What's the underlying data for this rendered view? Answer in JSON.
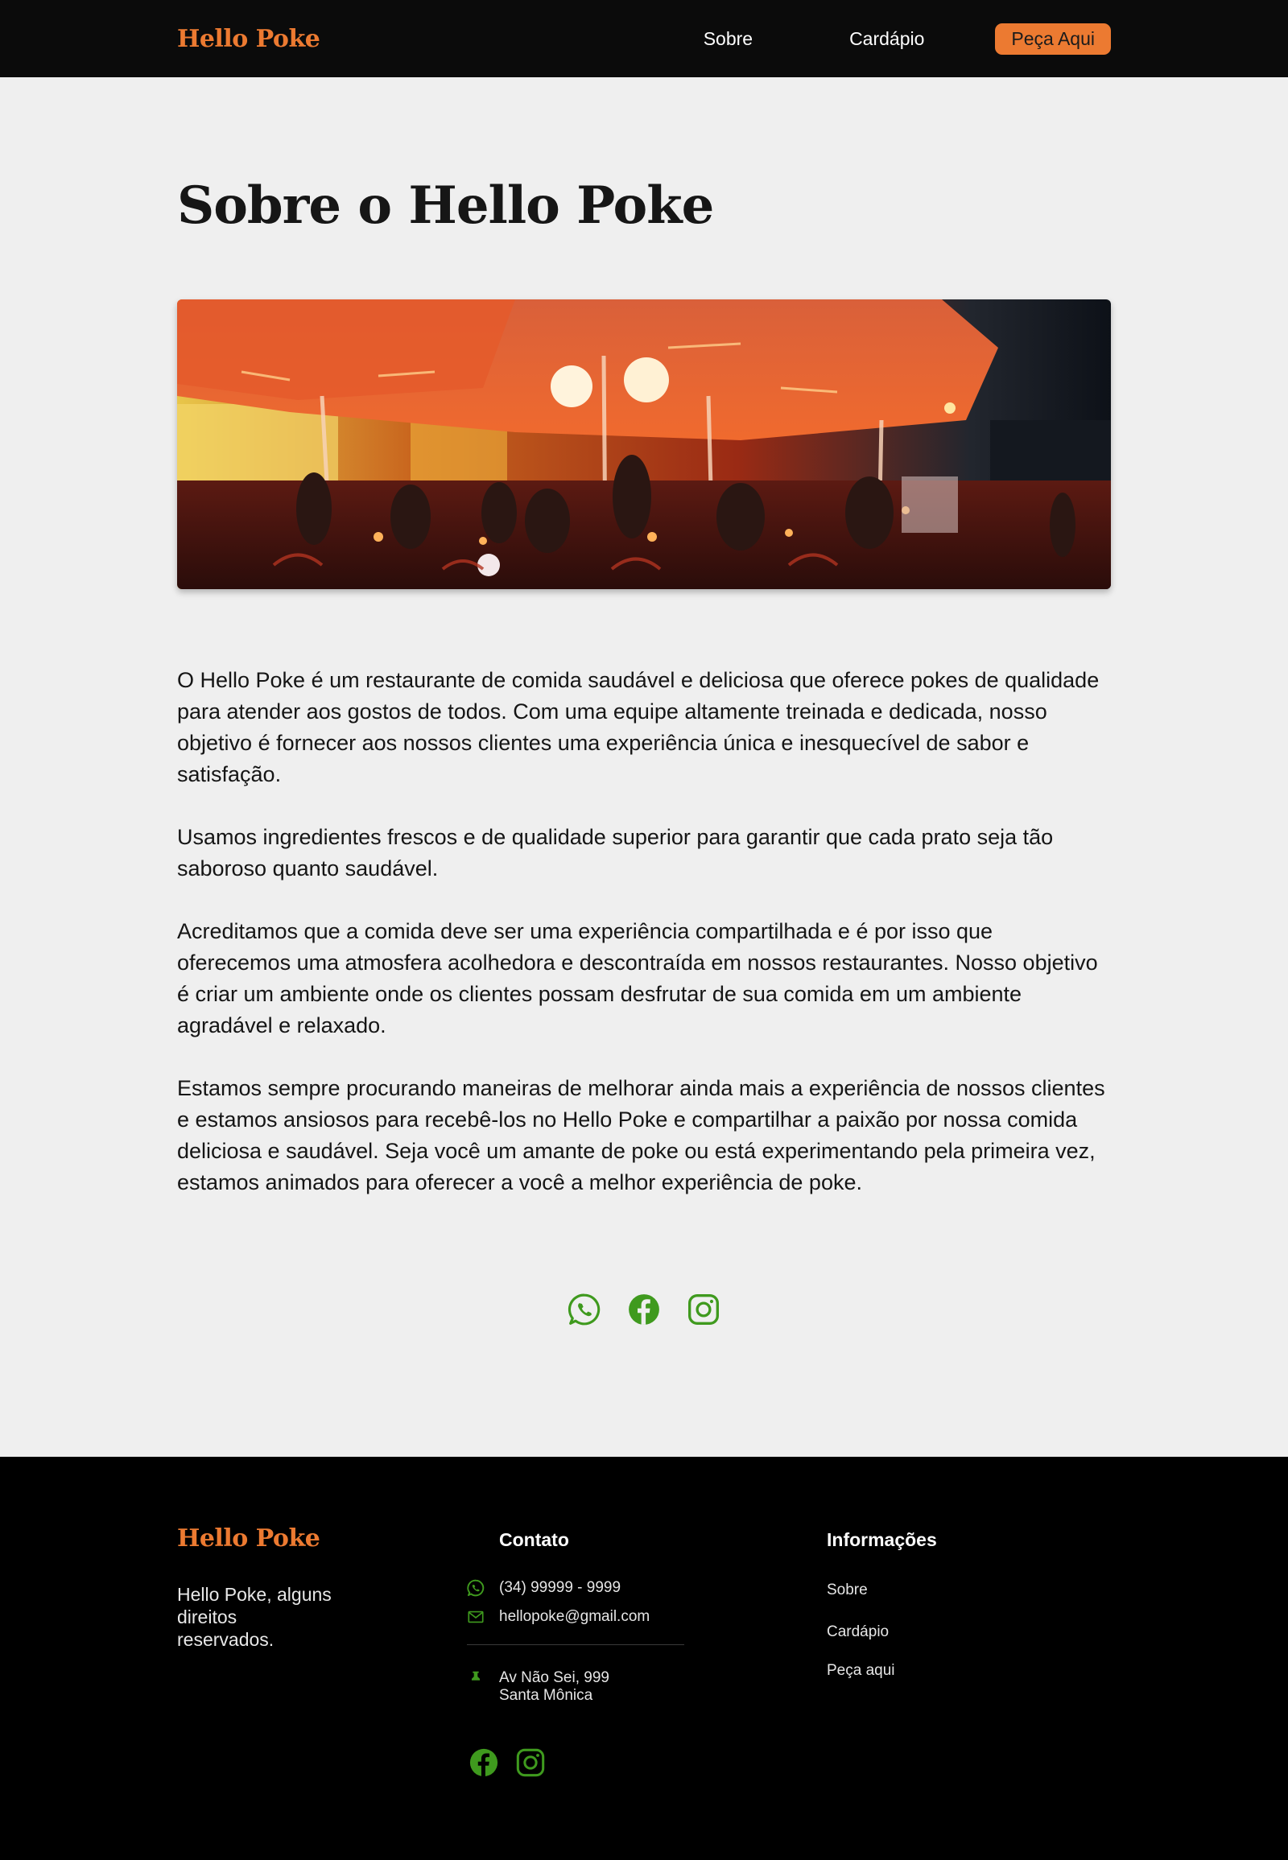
{
  "header": {
    "brand": "Hello Poke",
    "nav": {
      "sobre": "Sobre",
      "cardapio": "Cardápio",
      "cta": "Peça Aqui"
    }
  },
  "main": {
    "title": "Sobre o Hello Poke",
    "paragraphs": [
      "O Hello Poke é um restaurante de comida saudável e deliciosa que oferece pokes de qualidade para atender aos gostos de todos. Com uma equipe altamente treinada e dedicada, nosso objetivo é fornecer aos nossos clientes uma experiência única e inesquecível de sabor e satisfação.",
      "Usamos ingredientes frescos e de qualidade superior para garantir que cada prato seja tão saboroso quanto saudável.",
      "Acreditamos que a comida deve ser uma experiência compartilhada e é por isso que oferecemos uma atmosfera acolhedora e descontraída em nossos restaurantes. Nosso objetivo é criar um ambiente onde os clientes possam desfrutar de sua comida em um ambiente agradável e relaxado.",
      "Estamos sempre procurando maneiras de melhorar ainda mais a experiência de nossos clientes e estamos ansiosos para recebê-los no Hello Poke e compartilhar a paixão por nossa comida deliciosa e saudável. Seja você um amante de poke ou está experimentando pela primeira vez, estamos animados para oferecer a você a melhor experiência de poke."
    ],
    "social_icons": [
      "whatsapp-icon",
      "facebook-icon",
      "instagram-icon"
    ]
  },
  "footer": {
    "brand": "Hello Poke",
    "rights": "Hello Poke, alguns direitos reservados.",
    "contact": {
      "heading": "Contato",
      "phone": "(34) 99999 - 9999",
      "email": "hellopoke@gmail.com",
      "address_line1": "Av Não Sei, 999",
      "address_line2": "Santa Mônica"
    },
    "info": {
      "heading": "Informações",
      "links": [
        "Sobre",
        "Cardápio",
        "Peça aqui"
      ]
    },
    "social_icons": [
      "facebook-icon",
      "instagram-icon"
    ]
  },
  "colors": {
    "accent": "#ec7a31",
    "icon_green": "#3f9a1e",
    "header_bg": "#0b0b0b",
    "footer_bg": "#000000",
    "page_bg": "#efefef"
  }
}
